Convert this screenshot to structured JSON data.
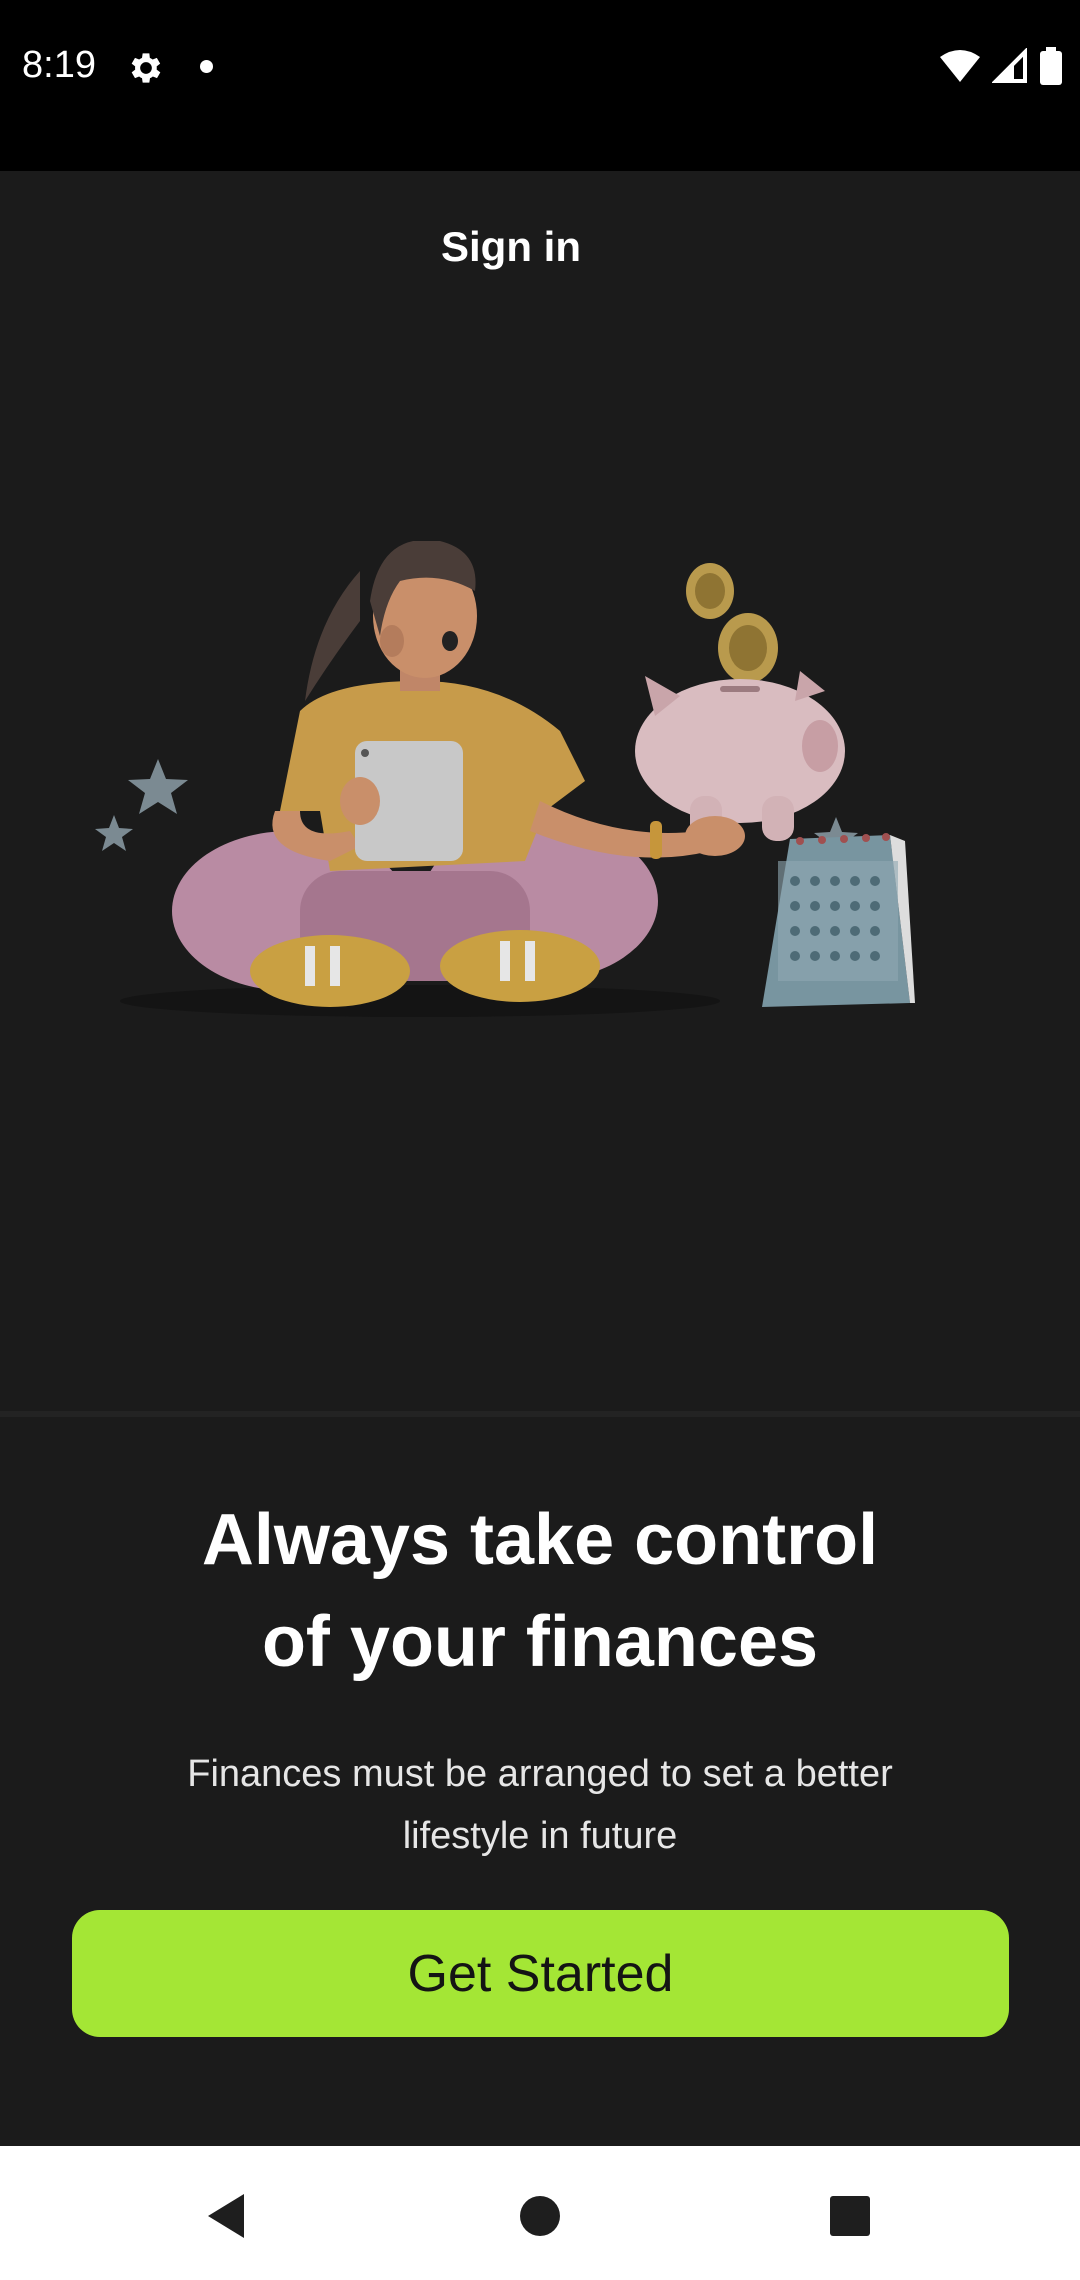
{
  "status_bar": {
    "time": "8:19",
    "icons": [
      "gear-icon",
      "notification-dot-icon",
      "wifi-icon",
      "signal-icon",
      "battery-icon"
    ]
  },
  "header": {
    "title": "Sign in"
  },
  "illustration": {
    "description_icons": [
      "woman-with-tablet-icon",
      "piggy-bank-icon",
      "bitcoin-coin-icon",
      "calendar-icon",
      "star-icon"
    ]
  },
  "onboarding": {
    "headline_line1": "Always take control",
    "headline_line2": "of your finances",
    "subtext_line1": "Finances must be arranged to set a better",
    "subtext_line2": "lifestyle in future",
    "cta_label": "Get Started"
  },
  "colors": {
    "background": "#1b1b1b",
    "accent": "#a4e635",
    "cta_text": "#141414"
  },
  "nav_bar": {
    "icons": [
      "back-icon",
      "home-icon",
      "recents-icon"
    ]
  }
}
